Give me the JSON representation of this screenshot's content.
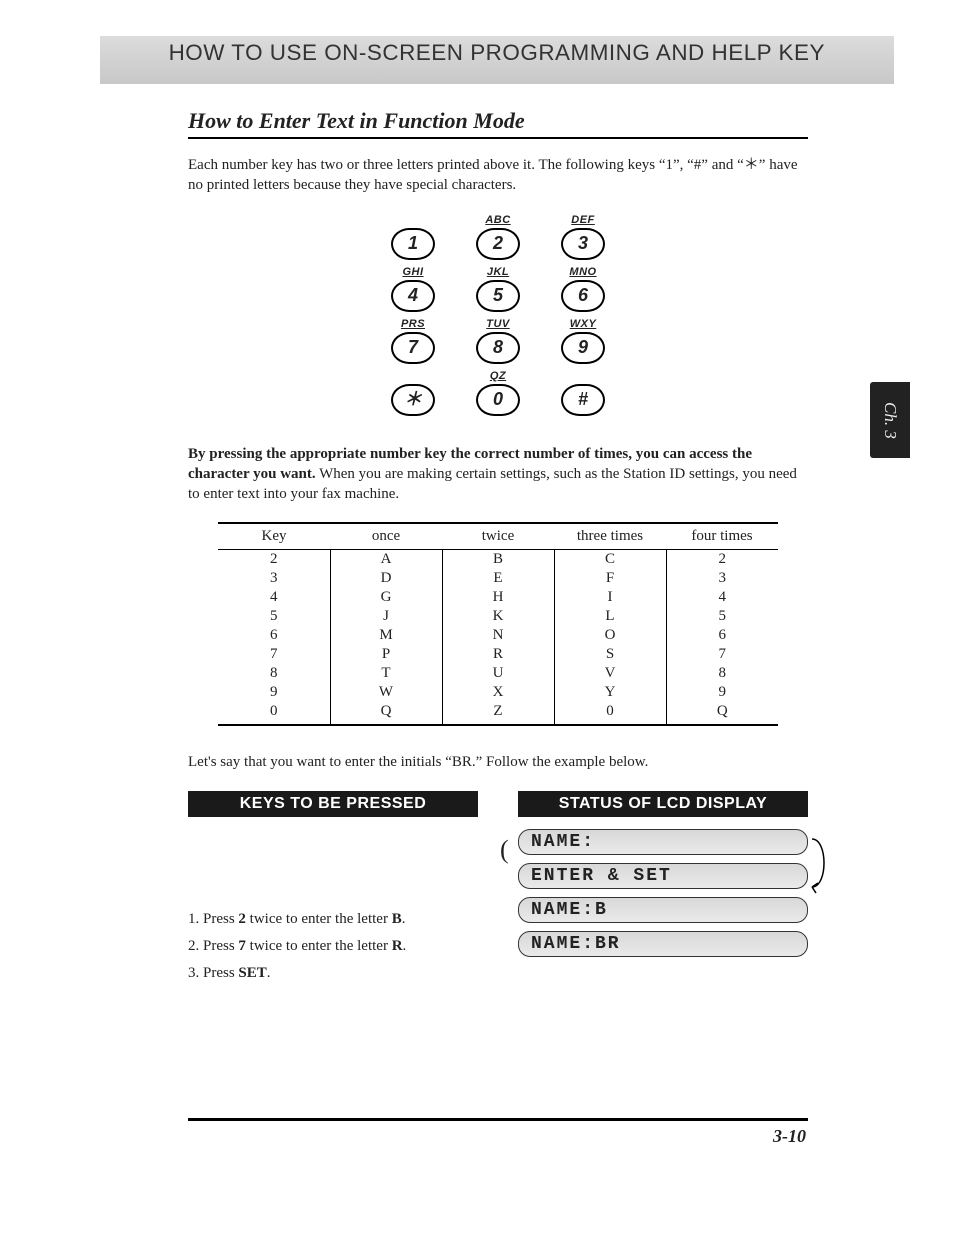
{
  "header": {
    "title": "HOW TO USE ON-SCREEN PROGRAMMING AND HELP KEY"
  },
  "side_tab": "Ch. 3",
  "title": "How to Enter Text in Function Mode",
  "intro": "Each number key has two or three letters printed above it. The following keys “1”, “#” and “＊” have no printed letters because they have special characters.",
  "keypad": [
    [
      {
        "label": "",
        "key": "1"
      },
      {
        "label": "ABC",
        "key": "2"
      },
      {
        "label": "DEF",
        "key": "3"
      }
    ],
    [
      {
        "label": "GHI",
        "key": "4"
      },
      {
        "label": "JKL",
        "key": "5"
      },
      {
        "label": "MNO",
        "key": "6"
      }
    ],
    [
      {
        "label": "PRS",
        "key": "7"
      },
      {
        "label": "TUV",
        "key": "8"
      },
      {
        "label": "WXY",
        "key": "9"
      }
    ],
    [
      {
        "label": "",
        "key": "＊"
      },
      {
        "label": "QZ",
        "key": "0"
      },
      {
        "label": "",
        "key": "#"
      }
    ]
  ],
  "mid_para_bold": "By pressing the appropriate number key the correct number of times, you can access the character you want.",
  "mid_para_rest": " When you are making certain settings, such as the Station ID settings, you need to enter text into your fax machine.",
  "table_headers": [
    "Key",
    "once",
    "twice",
    "three times",
    "four times"
  ],
  "table_rows": [
    [
      "2",
      "A",
      "B",
      "C",
      "2"
    ],
    [
      "3",
      "D",
      "E",
      "F",
      "3"
    ],
    [
      "4",
      "G",
      "H",
      "I",
      "4"
    ],
    [
      "5",
      "J",
      "K",
      "L",
      "5"
    ],
    [
      "6",
      "M",
      "N",
      "O",
      "6"
    ],
    [
      "7",
      "P",
      "R",
      "S",
      "7"
    ],
    [
      "8",
      "T",
      "U",
      "V",
      "8"
    ],
    [
      "9",
      "W",
      "X",
      "Y",
      "9"
    ],
    [
      "0",
      "Q",
      "Z",
      "0",
      "Q"
    ]
  ],
  "example_intro": "Let's say that you want to enter the initials “BR.” Follow the example below.",
  "keys_header": "KEYS TO BE PRESSED",
  "lcd_header": "STATUS OF LCD DISPLAY",
  "lcd_lines": {
    "l1": "NAME:",
    "l2": "ENTER & SET",
    "l3": "NAME:B",
    "l4": "NAME:BR"
  },
  "steps": {
    "s1_a": "1. Press ",
    "s1_b": "2",
    "s1_c": " twice to enter the letter ",
    "s1_d": "B",
    "s1_e": ".",
    "s2_a": "2. Press ",
    "s2_b": "7",
    "s2_c": " twice to enter the letter ",
    "s2_d": "R",
    "s2_e": ".",
    "s3_a": "3. Press ",
    "s3_b": "SET",
    "s3_c": "."
  },
  "page_number": "3-10"
}
